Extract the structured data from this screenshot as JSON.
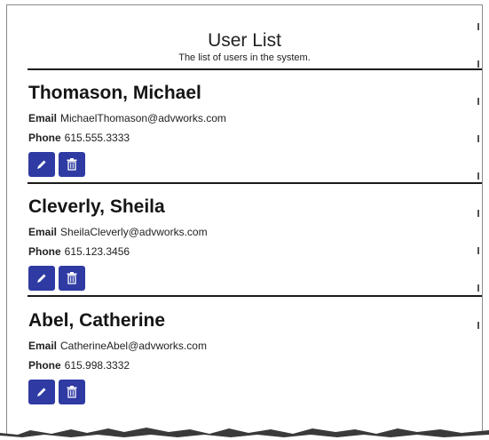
{
  "header": {
    "title": "User List",
    "subtitle": "The list of users in the system."
  },
  "labels": {
    "email": "Email",
    "phone": "Phone"
  },
  "users": [
    {
      "name": "Thomason, Michael",
      "email": "MichaelThomason@advworks.com",
      "phone": "615.555.3333"
    },
    {
      "name": "Cleverly, Sheila",
      "email": "SheilaCleverly@advworks.com",
      "phone": "615.123.3456"
    },
    {
      "name": "Abel, Catherine",
      "email": "CatherineAbel@advworks.com",
      "phone": "615.998.3332"
    }
  ],
  "icons": {
    "edit": "pencil-icon",
    "delete": "trash-icon"
  },
  "colors": {
    "button_bg": "#2f3aa3",
    "divider": "#1a1a1a"
  }
}
